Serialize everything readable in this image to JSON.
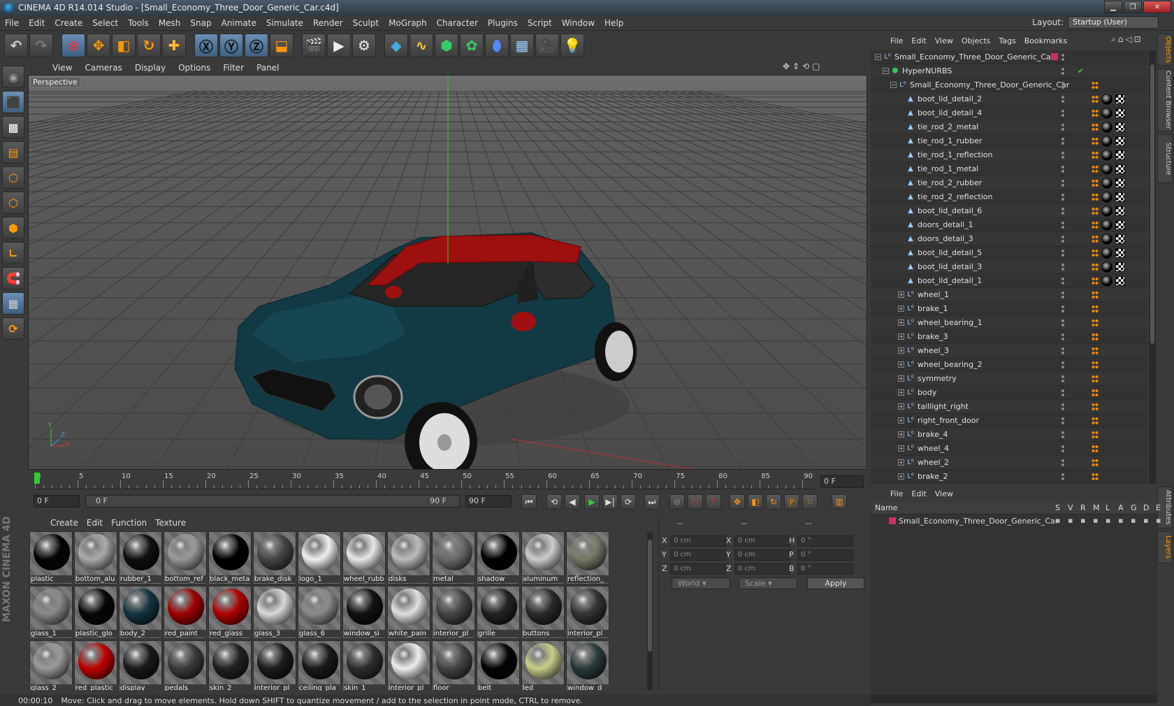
{
  "window": {
    "title": "CINEMA 4D R14.014 Studio - [Small_Economy_Three_Door_Generic_Car.c4d]"
  },
  "menu": [
    "File",
    "Edit",
    "Create",
    "Select",
    "Tools",
    "Mesh",
    "Snap",
    "Animate",
    "Simulate",
    "Render",
    "Sculpt",
    "MoGraph",
    "Character",
    "Plugins",
    "Script",
    "Window",
    "Help"
  ],
  "layout": {
    "label": "Layout:",
    "value": "Startup (User)"
  },
  "viewport": {
    "menu": [
      "View",
      "Cameras",
      "Display",
      "Options",
      "Filter",
      "Panel"
    ],
    "label": "Perspective",
    "axis": {
      "x": "X",
      "y": "Y",
      "z": "Z"
    }
  },
  "timeline": {
    "ticks": [
      "0",
      "5",
      "10",
      "15",
      "20",
      "25",
      "30",
      "35",
      "40",
      "45",
      "50",
      "55",
      "60",
      "65",
      "70",
      "75",
      "80",
      "85",
      "90"
    ],
    "current": "0 F",
    "start": "0 F",
    "range_start": "0 F",
    "range_end": "90 F",
    "end": "90 F"
  },
  "materials": {
    "menu": [
      "Create",
      "Edit",
      "Function",
      "Texture"
    ],
    "items": [
      {
        "name": "plastic",
        "color": "#050505"
      },
      {
        "name": "bottom_alu",
        "color": "#aaaaaa"
      },
      {
        "name": "rubber_1",
        "color": "#101010"
      },
      {
        "name": "bottom_ref",
        "color": "#999999"
      },
      {
        "name": "black_meta",
        "color": "#000000"
      },
      {
        "name": "brake_disk",
        "color": "#444444"
      },
      {
        "name": "logo_1",
        "color": "#f0f0f0"
      },
      {
        "name": "wheel_rubb",
        "color": "#e8e8e8"
      },
      {
        "name": "disks",
        "color": "#bbbbbb"
      },
      {
        "name": "metal",
        "color": "#6a6a6a"
      },
      {
        "name": "shadow",
        "color": "#000000"
      },
      {
        "name": "aluminum",
        "color": "#cccccc"
      },
      {
        "name": "reflection_",
        "color": "#777766"
      },
      {
        "name": "glass_1",
        "color": "#888888"
      },
      {
        "name": "plastic_glo",
        "color": "#080808"
      },
      {
        "name": "body_2",
        "color": "#133440"
      },
      {
        "name": "red_paint",
        "color": "#a00000"
      },
      {
        "name": "red_glass",
        "color": "#b00000"
      },
      {
        "name": "glass_3",
        "color": "#d8d8d8"
      },
      {
        "name": "glass_6",
        "color": "#8a8a8a"
      },
      {
        "name": "window_si",
        "color": "#111111"
      },
      {
        "name": "white_pain",
        "color": "#e0e0e0"
      },
      {
        "name": "interior_pl",
        "color": "#444444"
      },
      {
        "name": "grille",
        "color": "#222222"
      },
      {
        "name": "buttons",
        "color": "#2a2a2a"
      },
      {
        "name": "interior_pl",
        "color": "#333333"
      },
      {
        "name": "glass_2",
        "color": "#999999"
      },
      {
        "name": "red_plastic",
        "color": "#c00000"
      },
      {
        "name": "display",
        "color": "#1a1a1a"
      },
      {
        "name": "pedals",
        "color": "#3a3a3a"
      },
      {
        "name": "skin_2",
        "color": "#222222"
      },
      {
        "name": "interior_pl",
        "color": "#1c1c1c"
      },
      {
        "name": "ceiling_pla",
        "color": "#1a1a1a"
      },
      {
        "name": "skin_1",
        "color": "#2e2e2e"
      },
      {
        "name": "interior_pl",
        "color": "#eeeeee"
      },
      {
        "name": "floor",
        "color": "#444444"
      },
      {
        "name": "belt",
        "color": "#050505"
      },
      {
        "name": "led",
        "color": "#c8cc88"
      },
      {
        "name": "window_d",
        "color": "#2a3a3a"
      }
    ]
  },
  "coords": {
    "headers": [
      "--",
      "--",
      "--"
    ],
    "rows": [
      {
        "a": "X",
        "av": "0 cm",
        "b": "X",
        "bv": "0 cm",
        "c": "H",
        "cv": "0 °"
      },
      {
        "a": "Y",
        "av": "0 cm",
        "b": "Y",
        "bv": "0 cm",
        "c": "P",
        "cv": "0 °"
      },
      {
        "a": "Z",
        "av": "0 cm",
        "b": "Z",
        "bv": "0 cm",
        "c": "B",
        "cv": "0 °"
      }
    ],
    "mode": "World",
    "scale": "Scale",
    "apply": "Apply"
  },
  "objects": {
    "menu": [
      "File",
      "Edit",
      "View",
      "Objects",
      "Tags",
      "Bookmarks"
    ],
    "items": [
      {
        "name": "Small_Economy_Three_Door_Generic_Car",
        "indent": 0,
        "kind": "null",
        "mat": false
      },
      {
        "name": "HyperNURBS",
        "indent": 1,
        "kind": "nurbs",
        "mat": false
      },
      {
        "name": "Small_Economy_Three_Door_Generic_Car",
        "indent": 2,
        "kind": "null",
        "mat": false
      },
      {
        "name": "boot_lid_detail_2",
        "indent": 3,
        "kind": "poly",
        "mat": true
      },
      {
        "name": "boot_lid_detail_4",
        "indent": 3,
        "kind": "poly",
        "mat": true
      },
      {
        "name": "tie_rod_2_metal",
        "indent": 3,
        "kind": "poly",
        "mat": true
      },
      {
        "name": "tie_rod_1_rubber",
        "indent": 3,
        "kind": "poly",
        "mat": true
      },
      {
        "name": "tie_rod_1_reflection",
        "indent": 3,
        "kind": "poly",
        "mat": true
      },
      {
        "name": "tie_rod_1_metal",
        "indent": 3,
        "kind": "poly",
        "mat": true
      },
      {
        "name": "tie_rod_2_rubber",
        "indent": 3,
        "kind": "poly",
        "mat": true
      },
      {
        "name": "tie_rod_2_reflection",
        "indent": 3,
        "kind": "poly",
        "mat": true
      },
      {
        "name": "boot_lid_detail_6",
        "indent": 3,
        "kind": "poly",
        "mat": true
      },
      {
        "name": "doors_detail_1",
        "indent": 3,
        "kind": "poly",
        "mat": true
      },
      {
        "name": "doors_detail_3",
        "indent": 3,
        "kind": "poly",
        "mat": true
      },
      {
        "name": "boot_lid_detail_5",
        "indent": 3,
        "kind": "poly",
        "mat": true
      },
      {
        "name": "boot_lid_detail_3",
        "indent": 3,
        "kind": "poly",
        "mat": true
      },
      {
        "name": "boot_lid_detail_1",
        "indent": 3,
        "kind": "poly",
        "mat": true
      },
      {
        "name": "wheel_1",
        "indent": 3,
        "kind": "group",
        "mat": false
      },
      {
        "name": "brake_1",
        "indent": 3,
        "kind": "group",
        "mat": false
      },
      {
        "name": "wheel_bearing_1",
        "indent": 3,
        "kind": "group",
        "mat": false
      },
      {
        "name": "brake_3",
        "indent": 3,
        "kind": "group",
        "mat": false
      },
      {
        "name": "wheel_3",
        "indent": 3,
        "kind": "group",
        "mat": false
      },
      {
        "name": "wheel_bearing_2",
        "indent": 3,
        "kind": "group",
        "mat": false
      },
      {
        "name": "symmetry",
        "indent": 3,
        "kind": "group",
        "mat": false
      },
      {
        "name": "body",
        "indent": 3,
        "kind": "group",
        "mat": false
      },
      {
        "name": "taillight_right",
        "indent": 3,
        "kind": "group",
        "mat": false
      },
      {
        "name": "right_front_door",
        "indent": 3,
        "kind": "group",
        "mat": false
      },
      {
        "name": "brake_4",
        "indent": 3,
        "kind": "group",
        "mat": false
      },
      {
        "name": "wheel_4",
        "indent": 3,
        "kind": "group",
        "mat": false
      },
      {
        "name": "wheel_2",
        "indent": 3,
        "kind": "group",
        "mat": false
      },
      {
        "name": "brake_2",
        "indent": 3,
        "kind": "group",
        "mat": false
      }
    ]
  },
  "side_tabs": [
    "Objects",
    "Content Browser",
    "Structure"
  ],
  "layers": {
    "menu": [
      "File",
      "Edit",
      "View"
    ],
    "header": {
      "name": "Name",
      "cols": [
        "S",
        "V",
        "R",
        "M",
        "L",
        "A",
        "G",
        "D",
        "E"
      ]
    },
    "items": [
      {
        "name": "Small_Economy_Three_Door_Generic_Car",
        "color": "#d0305a"
      }
    ],
    "side_tabs": [
      "Attributes",
      "Layers"
    ]
  },
  "status": {
    "time": "00:00:10",
    "message": "Move: Click and drag to move elements. Hold down SHIFT to quantize movement / add to the selection in point mode, CTRL to remove."
  },
  "colors": {
    "accent": "#6b8fb5",
    "car_body": "#123a44",
    "car_roof": "#9c1010",
    "grid": "#3c3c3c"
  }
}
